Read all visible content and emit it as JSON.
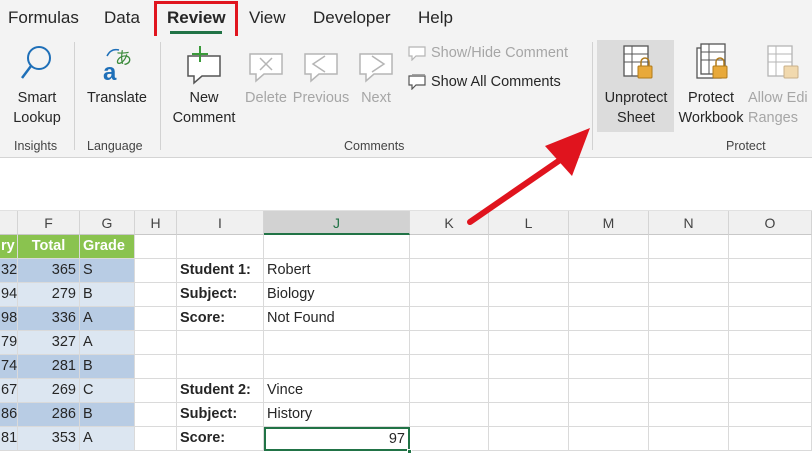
{
  "tabs": [
    "Formulas",
    "Data",
    "Review",
    "View",
    "Developer",
    "Help"
  ],
  "active_tab": "Review",
  "ribbon": {
    "insights": {
      "smart_lookup": "Smart",
      "smart_lookup_2": "Lookup",
      "group": "Insights"
    },
    "language": {
      "translate": "Translate",
      "group": "Language"
    },
    "comments": {
      "new_comment": "New",
      "new_comment_2": "Comment",
      "delete": "Delete",
      "previous": "Previous",
      "next": "Next",
      "show_hide": "Show/Hide Comment",
      "show_all": "Show All Comments",
      "group": "Comments"
    },
    "protect": {
      "unprotect_sheet": "Unprotect",
      "unprotect_sheet_2": "Sheet",
      "protect_workbook": "Protect",
      "protect_workbook_2": "Workbook",
      "allow_edit": "Allow Edi",
      "allow_edit_2": "Ranges",
      "group": "Protect"
    }
  },
  "columns": [
    "F",
    "G",
    "H",
    "I",
    "J",
    "K",
    "L",
    "M",
    "N",
    "O"
  ],
  "table": {
    "headers": [
      "ry",
      "Total",
      "Grade"
    ],
    "rows": [
      [
        "32",
        "365",
        "S"
      ],
      [
        "94",
        "279",
        "B"
      ],
      [
        "98",
        "336",
        "A"
      ],
      [
        "79",
        "327",
        "A"
      ],
      [
        "74",
        "281",
        "B"
      ],
      [
        "67",
        "269",
        "C"
      ],
      [
        "86",
        "286",
        "B"
      ],
      [
        "81",
        "353",
        "A"
      ]
    ]
  },
  "lookup": {
    "student1_label": "Student 1:",
    "student1_value": "Robert",
    "subject1_label": "Subject:",
    "subject1_value": "Biology",
    "score1_label": "Score:",
    "score1_value": "Not Found",
    "student2_label": "Student 2:",
    "student2_value": "Vince",
    "subject2_label": "Subject:",
    "subject2_value": "History",
    "score2_label": "Score:",
    "score2_value": "97"
  }
}
